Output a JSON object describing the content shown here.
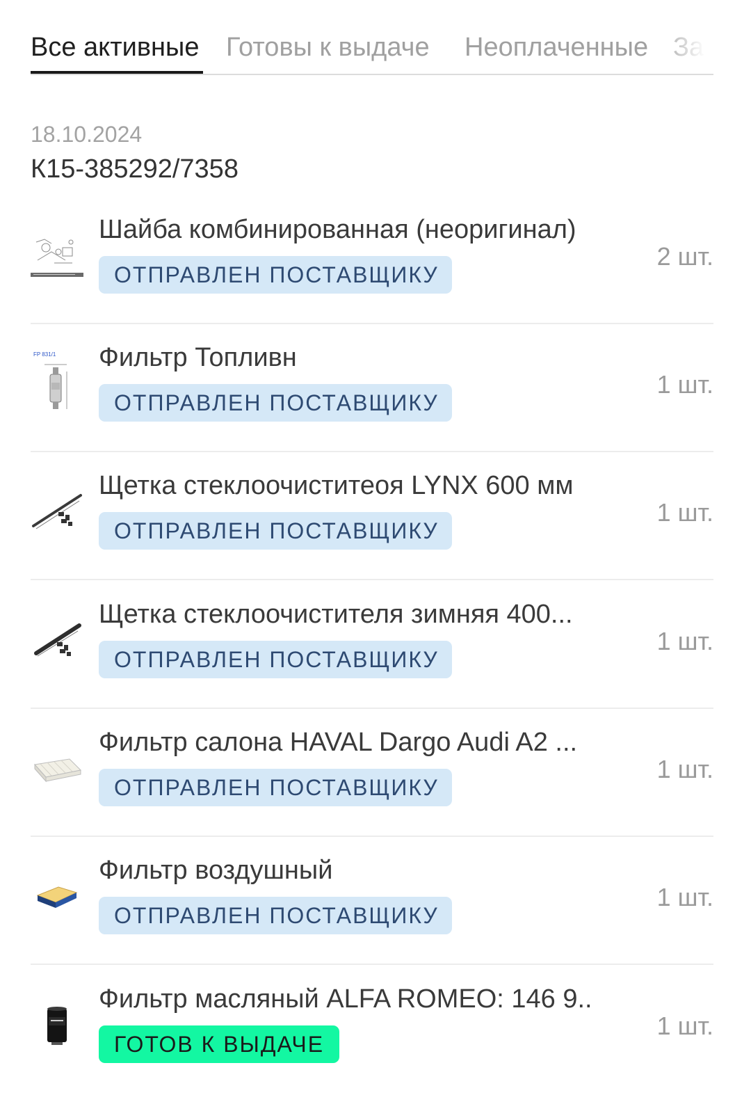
{
  "tabs": [
    {
      "label": "Все активные",
      "active": true
    },
    {
      "label": "Готовы к выдаче",
      "active": false
    },
    {
      "label": "Неоплаченные",
      "active": false
    },
    {
      "label": "За",
      "active": false
    }
  ],
  "order": {
    "date": "18.10.2024",
    "number": "К15-385292/7358"
  },
  "items": [
    {
      "name": "Шайба комбинированная (неоригинал)",
      "status": "ОТПРАВЛЕН ПОСТАВЩИКУ",
      "qty": "2 шт.",
      "icon": "washer-diagram-icon"
    },
    {
      "name": "Фильтр Топливн",
      "status": "ОТПРАВЛЕН ПОСТАВЩИКУ",
      "qty": "1 шт.",
      "icon": "fuel-filter-icon"
    },
    {
      "name": "Щетка стеклоочиститеоя LYNX 600 мм",
      "status": "ОТПРАВЛЕН ПОСТАВЩИКУ",
      "qty": "1 шт.",
      "icon": "wiper-blade-icon"
    },
    {
      "name": "Щетка стеклоочистителя зимняя 400...",
      "status": "ОТПРАВЛЕН ПОСТАВЩИКУ",
      "qty": "1 шт.",
      "icon": "winter-wiper-icon"
    },
    {
      "name": "Фильтр салона HAVAL Dargo Audi A2 ...",
      "status": "ОТПРАВЛЕН ПОСТАВЩИКУ",
      "qty": "1 шт.",
      "icon": "cabin-filter-icon"
    },
    {
      "name": "Фильтр воздушный",
      "status": "ОТПРАВЛЕН ПОСТАВЩИКУ",
      "qty": "1 шт.",
      "icon": "air-filter-icon"
    },
    {
      "name": "Фильтр масляный ALFA ROMEO: 146 9...",
      "status": "ГОТОВ К ВЫДАЧЕ",
      "qty": "1 шт.",
      "icon": "oil-filter-icon"
    }
  ],
  "colors": {
    "sent_badge_bg": "#d5e8f7",
    "sent_badge_text": "#2e4a72",
    "ready_badge_bg": "#13f7a2",
    "active_tab": "#1f1f1f",
    "inactive_tab": "#a0a0a0"
  }
}
